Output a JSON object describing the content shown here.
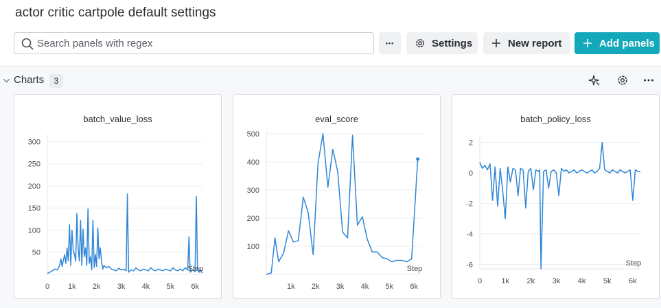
{
  "header": {
    "title": "actor critic cartpole default settings",
    "search_placeholder": "Search panels with regex",
    "more_label": "•••",
    "settings_label": "Settings",
    "new_report_label": "New report",
    "add_panels_label": "Add panels"
  },
  "section": {
    "title": "Charts",
    "count": "3"
  },
  "colors": {
    "accent": "#13a9ba",
    "series": "#2f86d6"
  },
  "icons": [
    "search-icon",
    "gear-icon",
    "plus-icon",
    "chevron-down-icon",
    "sparkle-icon",
    "more-icon"
  ],
  "chart_data": [
    {
      "type": "line",
      "title": "batch_value_loss",
      "xlabel": "Step",
      "xlim": [
        0,
        6300
      ],
      "ylim": [
        0,
        310
      ],
      "xticks": [
        0,
        1000,
        2000,
        3000,
        4000,
        5000,
        6000
      ],
      "xtick_labels": [
        "0",
        "1k",
        "2k",
        "3k",
        "4k",
        "5k",
        "6k"
      ],
      "yticks": [
        50,
        100,
        150,
        200,
        250,
        300
      ],
      "ytick_labels": [
        "50",
        "100",
        "150",
        "200",
        "250",
        "300"
      ],
      "series": [
        {
          "x": [
            0,
            100,
            200,
            300,
            400,
            500,
            550,
            600,
            700,
            750,
            800,
            850,
            900,
            950,
            1000,
            1050,
            1100,
            1150,
            1200,
            1250,
            1300,
            1350,
            1400,
            1450,
            1500,
            1550,
            1600,
            1650,
            1700,
            1750,
            1800,
            1850,
            1900,
            1950,
            2000,
            2050,
            2100,
            2150,
            2200,
            2250,
            2300,
            2400,
            2500,
            2600,
            2700,
            2800,
            2900,
            3000,
            3100,
            3200,
            3250,
            3300,
            3400,
            3500,
            3600,
            3700,
            3800,
            3900,
            4000,
            4100,
            4200,
            4300,
            4400,
            4500,
            4600,
            4700,
            4800,
            4900,
            5000,
            5100,
            5200,
            5300,
            5400,
            5500,
            5600,
            5700,
            5750,
            5800,
            5900,
            6000,
            6050,
            6100,
            6150,
            6200,
            6300
          ],
          "y": [
            2,
            5,
            8,
            12,
            10,
            20,
            35,
            18,
            45,
            25,
            60,
            30,
            112,
            20,
            100,
            55,
            45,
            30,
            138,
            60,
            30,
            122,
            20,
            102,
            40,
            60,
            20,
            148,
            25,
            40,
            10,
            122,
            15,
            45,
            18,
            105,
            35,
            60,
            30,
            12,
            20,
            15,
            18,
            12,
            10,
            8,
            14,
            10,
            12,
            8,
            182,
            5,
            10,
            8,
            15,
            10,
            8,
            12,
            10,
            8,
            15,
            10,
            8,
            12,
            10,
            8,
            12,
            10,
            8,
            15,
            10,
            8,
            12,
            8,
            15,
            10,
            85,
            5,
            10,
            6,
            176,
            10,
            5,
            12,
            3
          ]
        }
      ]
    },
    {
      "type": "line",
      "title": "eval_score",
      "xlabel": "Step",
      "xlim": [
        0,
        6300
      ],
      "ylim": [
        0,
        500
      ],
      "xticks": [
        1000,
        2000,
        3000,
        4000,
        5000,
        6000
      ],
      "xtick_labels": [
        "1k",
        "2k",
        "3k",
        "4k",
        "5k",
        "6k"
      ],
      "yticks": [
        100,
        200,
        300,
        400,
        500
      ],
      "ytick_labels": [
        "100",
        "200",
        "300",
        "400",
        "500"
      ],
      "series": [
        {
          "x": [
            0,
            200,
            350,
            500,
            700,
            900,
            1100,
            1300,
            1500,
            1700,
            1900,
            2100,
            2300,
            2500,
            2700,
            2900,
            3100,
            3300,
            3500,
            3700,
            3900,
            4100,
            4300,
            4500,
            4700,
            4900,
            5100,
            5300,
            5500,
            5700,
            5900,
            6150
          ],
          "y": [
            0,
            5,
            130,
            45,
            75,
            155,
            115,
            120,
            275,
            220,
            70,
            395,
            500,
            310,
            445,
            365,
            150,
            130,
            495,
            175,
            205,
            125,
            80,
            80,
            60,
            55,
            45,
            50,
            50,
            45,
            55,
            410
          ]
        }
      ]
    },
    {
      "type": "line",
      "title": "batch_policy_loss",
      "xlabel": "Step",
      "xlim": [
        0,
        6300
      ],
      "ylim": [
        -6.3,
        2.3
      ],
      "xticks": [
        0,
        1000,
        2000,
        3000,
        4000,
        5000,
        6000
      ],
      "xtick_labels": [
        "0",
        "1k",
        "2k",
        "3k",
        "4k",
        "5k",
        "6k"
      ],
      "yticks": [
        2,
        0,
        -2,
        -4,
        -6
      ],
      "ytick_labels": [
        "2",
        "0",
        "-2",
        "-4",
        "-6"
      ],
      "series": [
        {
          "x": [
            0,
            100,
            200,
            300,
            400,
            500,
            600,
            700,
            800,
            900,
            1000,
            1100,
            1200,
            1300,
            1400,
            1500,
            1600,
            1700,
            1800,
            1900,
            2000,
            2100,
            2200,
            2300,
            2350,
            2400,
            2500,
            2600,
            2700,
            2800,
            2900,
            3000,
            3100,
            3200,
            3300,
            3400,
            3500,
            3600,
            3700,
            3800,
            3900,
            4000,
            4100,
            4200,
            4300,
            4400,
            4500,
            4600,
            4700,
            4800,
            4900,
            5000,
            5100,
            5200,
            5300,
            5400,
            5500,
            5600,
            5700,
            5800,
            5900,
            6000,
            6100,
            6200,
            6300
          ],
          "y": [
            0.7,
            0.3,
            0.5,
            0.2,
            0.6,
            -1.8,
            0.4,
            -2.2,
            0.3,
            -1.2,
            -3.0,
            0.4,
            -0.6,
            0.3,
            0.2,
            -1.5,
            0.3,
            0.2,
            -2.3,
            0.1,
            0.3,
            -1.1,
            0.2,
            0.1,
            0.2,
            -6.3,
            0.1,
            0.2,
            -1.0,
            0.1,
            0.2,
            0.0,
            -1.5,
            0.3,
            0.1,
            0.2,
            0.0,
            0.1,
            0.2,
            0.0,
            0.1,
            0.2,
            0.1,
            0.0,
            0.1,
            0.2,
            0.0,
            0.1,
            0.3,
            2.0,
            0.2,
            0.1,
            0.0,
            0.2,
            0.1,
            0.0,
            0.2,
            0.1,
            0.0,
            0.1,
            0.2,
            -1.8,
            0.2,
            0.1,
            0.1
          ]
        }
      ]
    }
  ]
}
